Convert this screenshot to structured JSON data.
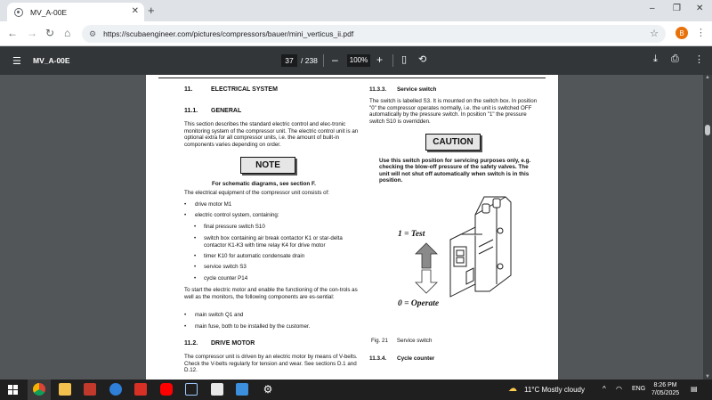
{
  "browser": {
    "tab_title": "MV_A-00E",
    "tab_close": "✕",
    "new_tab": "+",
    "window_controls": [
      "–",
      "❐",
      "✕"
    ],
    "url": "https://scubaengineer.com/pictures/compressors/bauer/mini_verticus_ii.pdf",
    "profile_initial": "B"
  },
  "pdf_toolbar": {
    "file_name": "MV_A-00E",
    "page_current": "37",
    "page_total": "/ 238",
    "zoom": "100%"
  },
  "doc": {
    "left": {
      "h11_num": "11.",
      "h11_title": "ELECTRICAL SYSTEM",
      "h111_num": "11.1.",
      "h111_title": "GENERAL",
      "p1": "This section describes the standard electric control and elec-tronic monitoring system of the compressor unit. The electric control unit is an optional extra for all compressor units, i.e. the amount of built-in components varies depending on order.",
      "note": "NOTE",
      "note_text": "For schematic diagrams, see section F.",
      "p2": "The electrical equipment of the compressor unit consists of:",
      "b1": "drive motor M1",
      "b2": "electric control system, containing:",
      "s1": "final pressure switch S10",
      "s2": "switch box containing air break contactor K1 or star-delta contactor K1-K3 with time relay K4 for drive motor",
      "s3": "timer K10 for automatic condensate drain",
      "s4": "service switch S3",
      "s5": "cycle counter P14",
      "p3": "To start the electric motor and enable the functioning of the con-trols as well as the monitors, the following components are es-sential:",
      "b3": "main switch Q1 and",
      "b4": "main fuse, both to be installed by the customer.",
      "h112_num": "11.2.",
      "h112_title": "DRIVE MOTOR",
      "p4": "The compressor unit is driven by an electric motor by means of V-belts. Check the V-belts regularly for tension and wear. See sections D.1 and D.12."
    },
    "right": {
      "h1133_num": "11.3.3.",
      "h1133_title": "Service switch",
      "p1": "The switch is labelled S3. It is mounted on the switch box. In position \"0\" the compressor operates normally, i.e. the unit is switched OFF automatically by the pressure switch. In position \"1\" the pressure switch S10 is overridden.",
      "caution": "CAUTION",
      "caution_text": "Use this switch position for servicing purposes only, e.g. checking the blow-off pressure of the safety valves. The unit will not shut off automatically when switch is in this position.",
      "label_test": "1 = Test",
      "label_operate": "0 = Operate",
      "fig_num": "Fig. 21",
      "fig_caption": "Service switch",
      "h1134_num": "11.3.4.",
      "h1134_title": "Cycle counter"
    }
  },
  "taskbar": {
    "weather": "11°C  Mostly cloudy",
    "lang": "ENG",
    "time": "8:26 PM",
    "date": "7/05/2025"
  }
}
